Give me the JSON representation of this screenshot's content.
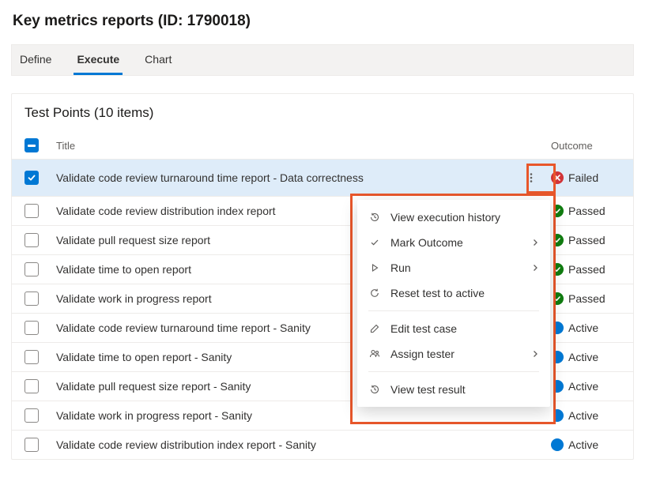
{
  "page": {
    "title": "Key metrics reports (ID: 1790018)"
  },
  "tabs": [
    {
      "label": "Define",
      "active": false
    },
    {
      "label": "Execute",
      "active": true
    },
    {
      "label": "Chart",
      "active": false
    }
  ],
  "panel": {
    "title": "Test Points (10 items)",
    "columns": {
      "title": "Title",
      "outcome": "Outcome"
    }
  },
  "rows": [
    {
      "title": "Validate code review turnaround time report - Data correctness",
      "outcome": "Failed",
      "outcome_state": "failed",
      "selected": true,
      "kebab": true
    },
    {
      "title": "Validate code review distribution index report",
      "outcome": "Passed",
      "outcome_state": "passed",
      "selected": false,
      "kebab": false
    },
    {
      "title": "Validate pull request size report",
      "outcome": "Passed",
      "outcome_state": "passed",
      "selected": false,
      "kebab": false
    },
    {
      "title": "Validate time to open report",
      "outcome": "Passed",
      "outcome_state": "passed",
      "selected": false,
      "kebab": false
    },
    {
      "title": "Validate work in progress report",
      "outcome": "Passed",
      "outcome_state": "passed",
      "selected": false,
      "kebab": false
    },
    {
      "title": "Validate code review turnaround time report - Sanity",
      "outcome": "Active",
      "outcome_state": "active",
      "selected": false,
      "kebab": false
    },
    {
      "title": "Validate time to open report - Sanity",
      "outcome": "Active",
      "outcome_state": "active",
      "selected": false,
      "kebab": false
    },
    {
      "title": "Validate pull request size report - Sanity",
      "outcome": "Active",
      "outcome_state": "active",
      "selected": false,
      "kebab": false
    },
    {
      "title": "Validate work in progress report - Sanity",
      "outcome": "Active",
      "outcome_state": "active",
      "selected": false,
      "kebab": false
    },
    {
      "title": "Validate code review distribution index report - Sanity",
      "outcome": "Active",
      "outcome_state": "active",
      "selected": false,
      "kebab": false
    }
  ],
  "context_menu": {
    "groups": [
      [
        {
          "icon": "history",
          "label": "View execution history",
          "submenu": false
        },
        {
          "icon": "check",
          "label": "Mark Outcome",
          "submenu": true
        },
        {
          "icon": "play",
          "label": "Run",
          "submenu": true
        },
        {
          "icon": "reset",
          "label": "Reset test to active",
          "submenu": false
        }
      ],
      [
        {
          "icon": "edit",
          "label": "Edit test case",
          "submenu": false
        },
        {
          "icon": "assign",
          "label": "Assign tester",
          "submenu": true
        }
      ],
      [
        {
          "icon": "history",
          "label": "View test result",
          "submenu": false
        }
      ]
    ]
  }
}
